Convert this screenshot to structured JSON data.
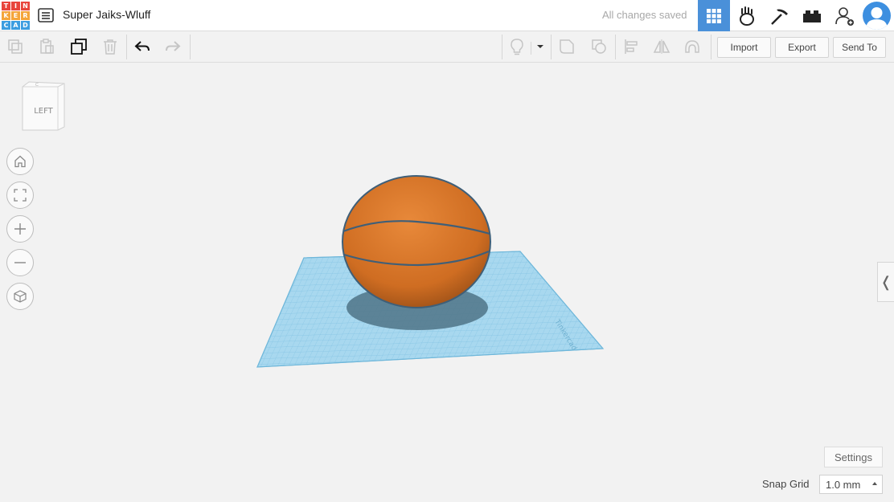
{
  "header": {
    "logo_letters": [
      "T",
      "I",
      "N",
      "K",
      "E",
      "R",
      "C",
      "A",
      "D"
    ],
    "logo_colors": [
      "#e8453c",
      "#e8453c",
      "#e8453c",
      "#f4a53b",
      "#f4a53b",
      "#f4a53b",
      "#3c9de0",
      "#3c9de0",
      "#3c9de0"
    ],
    "design_title": "Super Jaiks-Wluff",
    "save_status": "All changes saved",
    "icons": [
      "design-list-icon",
      "3d-view-grid-icon",
      "blocks-icon",
      "bricks-icon",
      "lego-brick-icon",
      "add-user-icon",
      "user-avatar"
    ]
  },
  "toolbar": {
    "icons": [
      "copy-icon",
      "paste-icon",
      "duplicate-icon",
      "trash-icon",
      "undo-icon",
      "redo-icon",
      "light-bulb-icon",
      "dropdown-caret-icon",
      "group-icon",
      "ungroup-icon",
      "align-icon",
      "mirror-icon",
      "cruise-icon"
    ],
    "import_label": "Import",
    "export_label": "Export",
    "send_to_label": "Send To"
  },
  "viewport": {
    "view_cube_label": "LEFT",
    "nav_icons": [
      "home-view-icon",
      "fit-view-icon",
      "zoom-in-icon",
      "zoom-out-icon",
      "ortho-view-icon"
    ],
    "workplane_color": "#a8d8ef",
    "ball_color": "#d9772a",
    "side_panel_toggle": "❬"
  },
  "footer": {
    "settings_label": "Settings",
    "snap_grid_label": "Snap Grid",
    "snap_grid_value": "1.0 mm"
  }
}
